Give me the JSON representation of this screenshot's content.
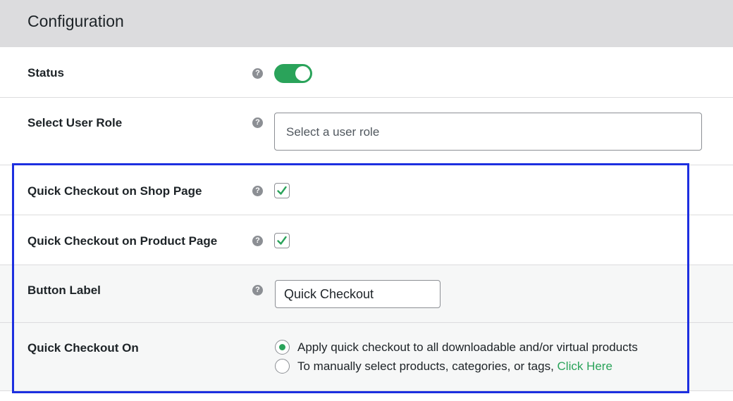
{
  "header": {
    "title": "Configuration"
  },
  "rows": {
    "status": {
      "label": "Status",
      "help": "?",
      "toggle_on": true
    },
    "user_role": {
      "label": "Select User Role",
      "help": "?",
      "placeholder": "Select a user role"
    },
    "shop_page": {
      "label": "Quick Checkout on Shop Page",
      "help": "?",
      "checked": true
    },
    "product_page": {
      "label": "Quick Checkout on Product Page",
      "help": "?",
      "checked": true
    },
    "button_label": {
      "label": "Button Label",
      "help": "?",
      "value": "Quick Checkout"
    },
    "checkout_on": {
      "label": "Quick Checkout On",
      "options": [
        {
          "text": "Apply quick checkout to all downloadable and/or virtual products",
          "selected": true
        },
        {
          "text": "To manually select products, categories, or tags, ",
          "link": "Click Here",
          "selected": false
        }
      ]
    }
  },
  "colors": {
    "accent": "#2aa35a",
    "highlight": "#1d2fe0",
    "header_bg": "#dcdcde"
  },
  "icons": {
    "help": "question-circle-icon",
    "check": "checkmark-icon"
  }
}
